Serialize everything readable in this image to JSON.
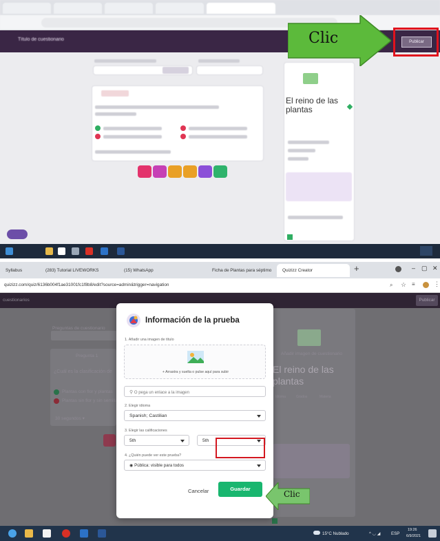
{
  "annotation": {
    "clic_label": "Clic"
  },
  "top": {
    "title": "Título de cuestionario",
    "publish_label": "Publicar",
    "side_panel_title": "El reino de las plantas"
  },
  "browser": {
    "tabs": [
      {
        "label": "Syllabus"
      },
      {
        "label": "(283) Tutorial LIVEWORKS"
      },
      {
        "label": "(15) WhatsApp"
      },
      {
        "label": "Ficha de Plantas para séptimo"
      },
      {
        "label": "Quizizz Creator"
      }
    ],
    "url": "quizizz.com/quiz/6136b004f1ae31001fc1f8b8/edit?source=admin&trigger=navigation"
  },
  "background": {
    "header_left": "cuestionarios",
    "header_right": "Publicar",
    "side_title": "El reino de las plantas",
    "side_add_image": "Añadir imagen de cuestionario",
    "side_label_1": "Idioma",
    "side_label_2": "Grados",
    "side_label_3": "Materia",
    "question_label": "Pregunta 1",
    "question_text": "¿Cuál es la clasificación de",
    "bg_left_1": "Preguntas de cuestionario",
    "bg_answer_1": "Plantas con flor y plantas",
    "bg_answer_2": "Plantas sin flor y sin semilla",
    "bg_controls": "30 segundos  ▾"
  },
  "modal": {
    "title": "Información de la prueba",
    "image_label": "1. Añadir una imagen de título",
    "dropzone_text": "+ Arrastra y suelta o pulse aquí para subir",
    "link_placeholder": "O pega un enlace a la imagen",
    "language_label": "2. Elegir idioma",
    "language_value": "Spanish; Castilian",
    "grades_label": "3. Elegir las calificaciones",
    "grade_from": "5th",
    "grade_to": "5th",
    "visibility_label": "4. ¿Quién puede ver este prueba?",
    "visibility_value": "Pública: visible para todos",
    "cancel_label": "Cancelar",
    "save_label": "Guardar"
  },
  "taskbar": {
    "weather": "15°C Nublado",
    "lang": "ESP",
    "time": "19:26",
    "date": "6/9/2021"
  },
  "colors": {
    "header": "#2f2434",
    "save": "#19b66f",
    "annotation_arrow": "#5cba3b",
    "highlight": "#e0121d"
  }
}
